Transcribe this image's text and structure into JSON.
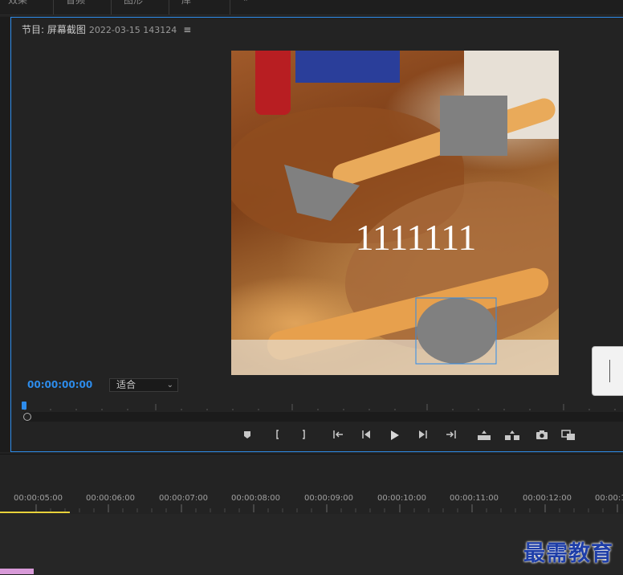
{
  "top_tabs": [
    "效果",
    "音频",
    "图形",
    "库",
    "»"
  ],
  "panel": {
    "title": "节目: 屏幕截图",
    "timestamp": "2022-03-15 143124",
    "menu_glyph": "≡"
  },
  "monitor": {
    "overlay_text": "1111111",
    "current_time": "00:00:00:00",
    "fit_label": "适合",
    "fit_chevron": "⌄"
  },
  "controls": [
    {
      "name": "add-marker-icon"
    },
    {
      "name": "mark-in-icon"
    },
    {
      "name": "mark-out-icon"
    },
    {
      "name": "go-to-in-icon"
    },
    {
      "name": "step-back-icon"
    },
    {
      "name": "play-icon"
    },
    {
      "name": "step-forward-icon"
    },
    {
      "name": "go-to-out-icon"
    },
    {
      "name": "lift-icon"
    },
    {
      "name": "extract-icon"
    },
    {
      "name": "export-frame-icon"
    },
    {
      "name": "compare-view-icon"
    }
  ],
  "timeline": {
    "timecodes": [
      "00:00:05:00",
      "00:00:06:00",
      "00:00:07:00",
      "00:00:08:00",
      "00:00:09:00",
      "00:00:10:00",
      "00:00:11:00",
      "00:00:12:00",
      "00:00:1"
    ],
    "work_area_color": "#e8d23a"
  },
  "colors": {
    "accent": "#2d8ceb",
    "panel_bg": "#232323",
    "shape_gray": "#808080"
  },
  "watermark": "最需教育"
}
